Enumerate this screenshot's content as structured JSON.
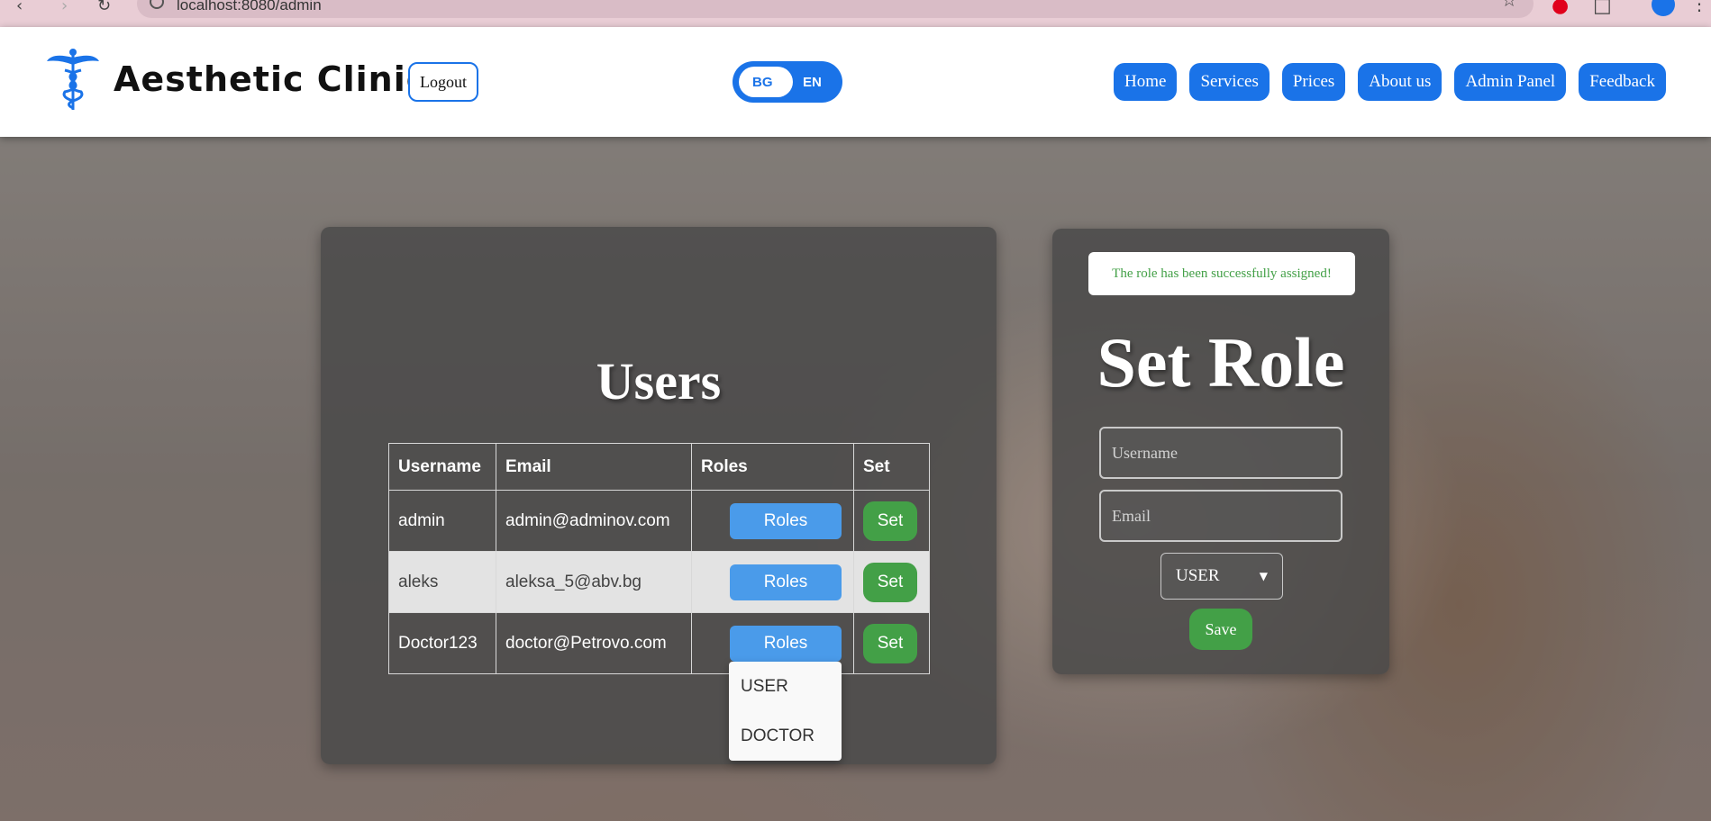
{
  "browser": {
    "url": "localhost:8080/admin"
  },
  "header": {
    "brand": "Aesthetic Clinic",
    "logout_label": "Logout",
    "languages": [
      "BG",
      "EN"
    ],
    "active_language": "EN",
    "nav": [
      "Home",
      "Services",
      "Prices",
      "About us",
      "Admin Panel",
      "Feedback"
    ],
    "accent_color": "#1a73e8"
  },
  "users": {
    "title": "Users",
    "columns": [
      "Username",
      "Email",
      "Roles",
      "Set"
    ],
    "rows": [
      {
        "username": "admin",
        "email": "admin@adminov.com",
        "roles_label": "Roles",
        "set_label": "Set"
      },
      {
        "username": "aleks",
        "email": "aleksa_5@abv.bg",
        "roles_label": "Roles",
        "set_label": "Set"
      },
      {
        "username": "Doctor123",
        "email": "doctor@Petrovo.com",
        "roles_label": "Roles",
        "set_label": "Set"
      }
    ],
    "roles_dropdown": [
      "USER",
      "DOCTOR"
    ]
  },
  "set_role": {
    "alert": "The role has been successfully assigned!",
    "title": "Set Role",
    "username_placeholder": "Username",
    "email_placeholder": "Email",
    "selected_role": "USER",
    "save_label": "Save",
    "success_color": "#43a047"
  }
}
